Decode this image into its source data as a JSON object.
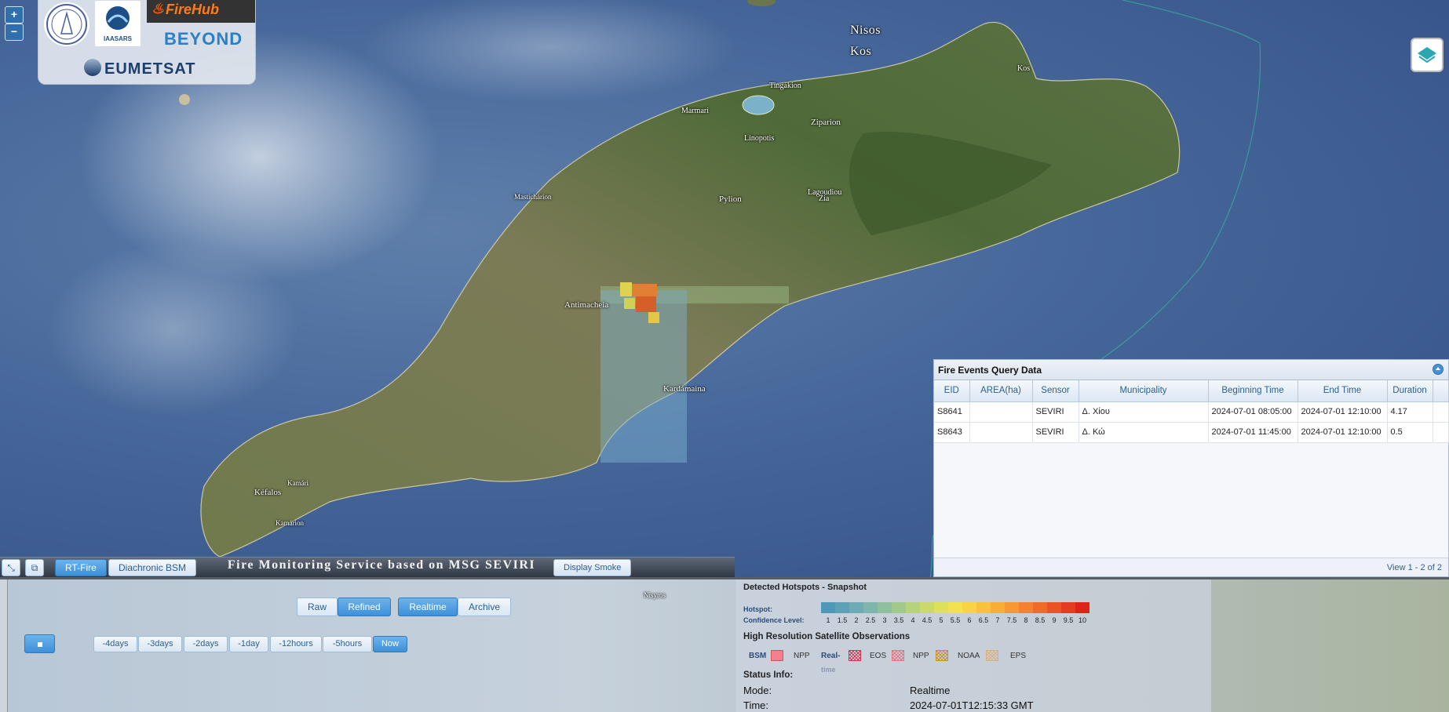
{
  "map": {
    "zoom_in": "+",
    "zoom_out": "−",
    "labels": {
      "nisos": "Nisos",
      "kos_region": "Kos",
      "kos_town": "Kos",
      "tingakion": "Tingákion",
      "marmari": "Marmari",
      "ziparion": "Ziparion",
      "linopotis": "Linopotis",
      "mastichari": "Mastichárion",
      "pylion": "Pylion",
      "lagoudi_zia": "Lagoudiou",
      "zia": "Zia",
      "antimacheia": "Antimacheia",
      "kardamaina": "Kardámaina",
      "kefalos": "Kéfalos",
      "kamari": "Kamári",
      "kamarion": "Kamárion",
      "nisyros": "Nisyros"
    },
    "logos": {
      "iaasars": "IAASARS",
      "firehub": "FireHub",
      "beyond": "BEYOND",
      "eumetsat": "EUMETSAT"
    }
  },
  "query_panel": {
    "title": "Fire Events Query Data",
    "columns": [
      "EID",
      "AREA(ha)",
      "Sensor",
      "Municipality",
      "Beginning Time",
      "End Time",
      "Duration"
    ],
    "rows": [
      [
        "S8641",
        "",
        "SEVIRI",
        "Δ. Χίου",
        "2024-07-01 08:05:00",
        "2024-07-01 12:10:00",
        "4.17"
      ],
      [
        "S8643",
        "",
        "SEVIRI",
        "Δ. Κώ",
        "2024-07-01 11:45:00",
        "2024-07-01 12:10:00",
        "0.5"
      ]
    ],
    "footer": "View 1 - 2 of 2"
  },
  "toolbar": {
    "rt_fire": "RT-Fire",
    "diachronic": "Diachronic BSM",
    "title": "Fire Monitoring Service based on MSG SEVIRI",
    "display_smoke": "Display Smoke"
  },
  "controls": {
    "raw": "Raw",
    "refined": "Refined",
    "realtime": "Realtime",
    "archive": "Archive",
    "time_buttons": [
      "-4days",
      "-3days",
      "-2days",
      "-1day",
      "-12hours",
      "-5hours",
      "Now"
    ]
  },
  "info": {
    "snapshot_title": "Detected Hotspots - Snapshot",
    "hotspot_label": "Hotspot:",
    "confidence_label": "Confidence Level:",
    "confidence_ticks": [
      "1",
      "1.5",
      "2",
      "2.5",
      "3",
      "3.5",
      "4",
      "4.5",
      "5",
      "5.5",
      "6",
      "6.5",
      "7",
      "7.5",
      "8",
      "8.5",
      "9",
      "9.5",
      "10"
    ],
    "ramp_colors": [
      "#4f98b8",
      "#5ea1b7",
      "#6eabb4",
      "#7eb5ad",
      "#8fbf9f",
      "#a2c98c",
      "#b6d27a",
      "#cad96a",
      "#dfe05a",
      "#f1e24f",
      "#f8d444",
      "#f9c23d",
      "#f9ad37",
      "#f89832",
      "#f4812d",
      "#f06b28",
      "#ea5423",
      "#e43c1e",
      "#de2419"
    ],
    "hires_title": "High Resolution Satellite Observations",
    "bsm": "BSM",
    "npp1": "NPP",
    "realtime_l1": "Real-",
    "realtime_l2": "time",
    "eos": "EOS",
    "npp2": "NPP",
    "noaa": "NOAA",
    "eps": "EPS",
    "status_title": "Status Info:",
    "mode_label": "Mode:",
    "mode_value": "Realtime",
    "time_label": "Time:",
    "time_value": "2024-07-01T12:15:33 GMT"
  }
}
